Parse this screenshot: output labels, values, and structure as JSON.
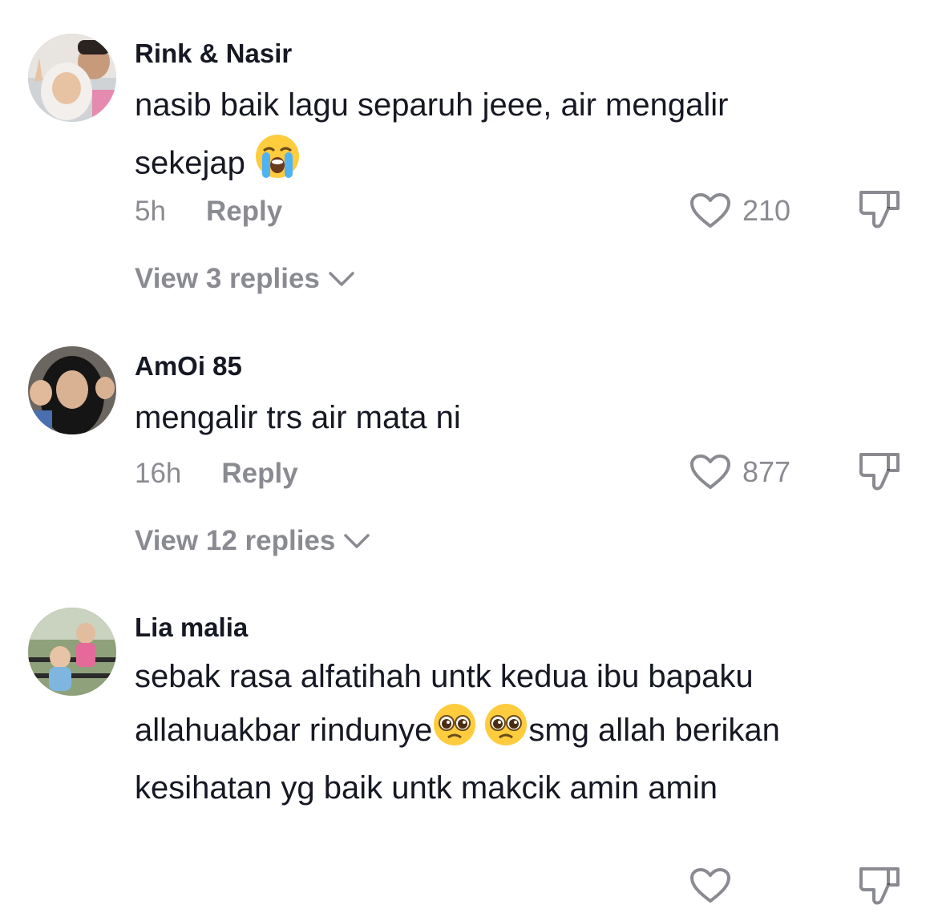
{
  "comments": [
    {
      "username": "Rink & Nasir",
      "text": "nasib baik lagu separuh jeee, air mengalir sekejap",
      "emoji": "loudly-crying-face",
      "time": "5h",
      "reply_label": "Reply",
      "likes": "210",
      "view_replies": "View 3 replies"
    },
    {
      "username": "AmOi 85",
      "text": "mengalir trs air mata ni",
      "time": "16h",
      "reply_label": "Reply",
      "likes": "877",
      "view_replies": "View 12 replies"
    },
    {
      "username": "Lia malia",
      "text_part1": "sebak rasa alfatihah untk kedua ibu bapaku allahuakbar rindunye",
      "emoji": "pleading-face",
      "text_part2": "smg allah berikan kesihatan yg baik untk makcik amin amin"
    }
  ],
  "colors": {
    "primary_text": "#161823",
    "secondary_text": "rgba(22,24,35,0.5)",
    "background": "#ffffff"
  }
}
